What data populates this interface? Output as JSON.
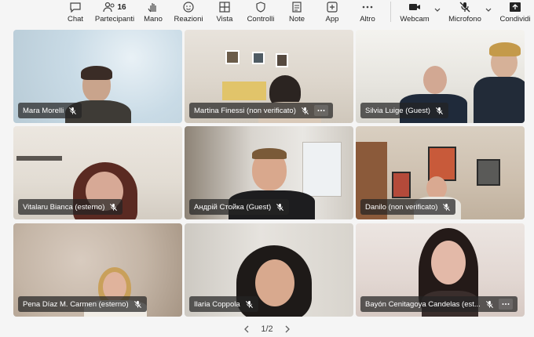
{
  "toolbar": {
    "chat": "Chat",
    "participants": "Partecipanti",
    "participants_count": "16",
    "raise_hand": "Mano",
    "reactions": "Reazioni",
    "view": "Vista",
    "controls": "Controlli",
    "notes": "Note",
    "apps": "App",
    "more": "Altro",
    "webcam": "Webcam",
    "mic": "Microfono",
    "share": "Condividi"
  },
  "tiles": [
    {
      "name": "Mara Morelli"
    },
    {
      "name": "Martina Finessi (non verificato)"
    },
    {
      "name": "Silvia Luige (Guest)"
    },
    {
      "name": "Vitalaru Bianca (esterno)"
    },
    {
      "name": "Андрій Стойка (Guest)"
    },
    {
      "name": "Danilo (non verificato)"
    },
    {
      "name": "Pena Díaz M. Carmen (esterno)"
    },
    {
      "name": "Ilaria Coppola"
    },
    {
      "name": "Bayón Cenitagoya Candelas (est..."
    }
  ],
  "pager": {
    "label": "1/2"
  },
  "colors": {
    "toolbar_bg": "#f5f5f5",
    "pill_bg": "#242424",
    "page_bg": "#f5f5f5"
  }
}
